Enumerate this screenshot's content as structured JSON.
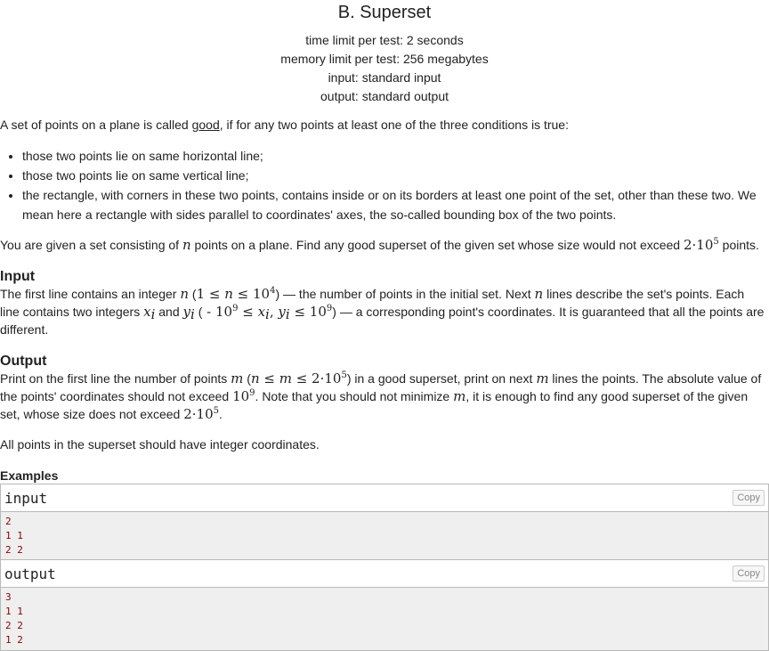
{
  "problem": {
    "title": "B. Superset",
    "time_limit": "time limit per test: 2 seconds",
    "memory_limit": "memory limit per test: 256 megabytes",
    "input_file": "input: standard input",
    "output_file": "output: standard output"
  },
  "statement": {
    "p1_before": "A set of points on a plane is called ",
    "p1_good": "good",
    "p1_after": ", if for any two points at least one of the three conditions is true:",
    "conditions": [
      "those two points lie on same horizontal line;",
      "those two points lie on same vertical line;",
      "the rectangle, with corners in these two points, contains inside or on its borders at least one point of the set, other than these two. We mean here a rectangle with sides parallel to coordinates' axes, the so-called bounding box of the two points."
    ],
    "p2_a": "You are given a set consisting of ",
    "p2_n": "n",
    "p2_b": " points on a plane. Find any good superset of the given set whose size would not exceed ",
    "p2_base": "2·10",
    "p2_exp": "5",
    "p2_c": " points."
  },
  "input": {
    "title": "Input",
    "a": "The first line contains an integer ",
    "n": "n",
    "b": " (",
    "m1": "1 ≤ ",
    "n2": "n",
    "m2": " ≤ 10",
    "e1": "4",
    "c": ") — the number of points in the initial set. Next ",
    "n3": "n",
    "d": " lines describe the set's points. Each line contains two integers ",
    "x": "x",
    "i1": "i",
    "e": " and ",
    "y": "y",
    "i2": "i",
    "f": " (",
    "m3": " - 10",
    "e2": "9",
    "m4": " ≤ ",
    "x2": "x",
    "i3": "i",
    "comma": ", ",
    "y2": "y",
    "i4": "i",
    "m5": " ≤ 10",
    "e3": "9",
    "g": ") — a corresponding point's coordinates. It is guaranteed that all the points are different."
  },
  "output": {
    "title": "Output",
    "a": "Print on the first line the number of points ",
    "m": "m",
    "b": " (",
    "n": "n",
    "m1": " ≤ ",
    "mm": "m",
    "m2": " ≤ 2·10",
    "e1": "5",
    "c": ") in a good superset, print on next ",
    "m3": "m",
    "d": " lines the points. The absolute value of the points' coordinates should not exceed ",
    "m4": "10",
    "e2": "9",
    "e": ". Note that you should not minimize ",
    "m5": "m",
    "f": ", it is enough to find any good superset of the given set, whose size does not exceed ",
    "m6": "2·10",
    "e3": "5",
    "g": ".",
    "p2": "All points in the superset should have integer coordinates."
  },
  "examples": {
    "title": "Examples",
    "copy_label": "Copy",
    "input_label": "input",
    "input_lines": [
      "2",
      "1 1",
      "2 2"
    ],
    "output_label": "output",
    "output_lines": [
      "3",
      "1 1",
      "2 2",
      "1 2"
    ]
  }
}
